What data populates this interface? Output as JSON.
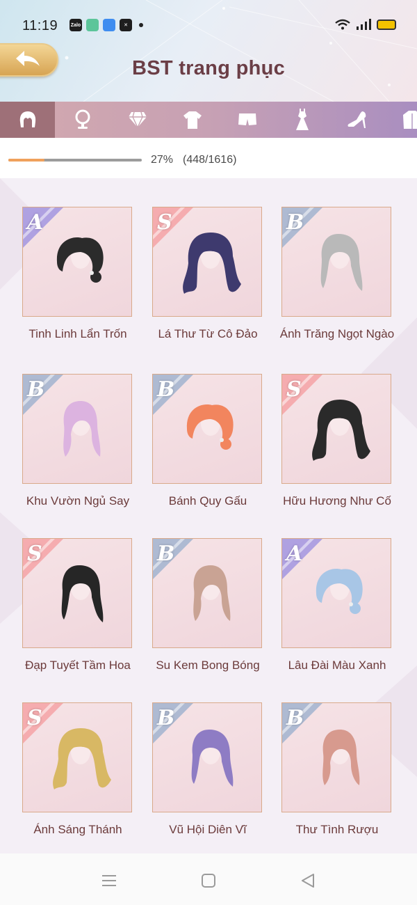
{
  "status": {
    "time": "11:19",
    "apps": [
      {
        "name": "zalo-icon",
        "label": "Zalo",
        "color": "#1e1e1e"
      },
      {
        "name": "app-green-icon",
        "label": "",
        "color": "#5cc59a"
      },
      {
        "name": "app-blue-icon",
        "label": "",
        "color": "#3f8df0"
      },
      {
        "name": "capcut-icon",
        "label": "",
        "color": "#1e1e1e"
      }
    ],
    "icons": [
      "wifi-icon",
      "signal-icon",
      "battery-icon"
    ]
  },
  "header": {
    "title": "BST trang phục",
    "back_icon": "back-arrow-icon",
    "title_color": "#6b3e46"
  },
  "tabs": [
    {
      "id": "hair",
      "icon": "hair-icon",
      "active": true
    },
    {
      "id": "face",
      "icon": "mirror-icon",
      "active": false
    },
    {
      "id": "jewelry",
      "icon": "diamond-icon",
      "active": false
    },
    {
      "id": "top",
      "icon": "shirt-icon",
      "active": false
    },
    {
      "id": "bottom",
      "icon": "shorts-icon",
      "active": false
    },
    {
      "id": "dress",
      "icon": "dress-icon",
      "active": false
    },
    {
      "id": "shoes",
      "icon": "heel-icon",
      "active": false
    },
    {
      "id": "coat",
      "icon": "coat-icon",
      "active": false
    }
  ],
  "progress": {
    "fraction": 0.27,
    "percent_text": "27%",
    "count_text": "(448/1616)"
  },
  "items": [
    {
      "rank": "A",
      "label": "Tinh Linh Lẩn Trốn",
      "hair_color": "#2b2b2b"
    },
    {
      "rank": "S",
      "label": "Lá Thư Từ Cô Đảo",
      "hair_color": "#3e3a6e"
    },
    {
      "rank": "B",
      "label": "Ánh Trăng Ngọt Ngào",
      "hair_color": "#b9b9b9"
    },
    {
      "rank": "B",
      "label": "Khu Vườn Ngủ Say",
      "hair_color": "#dcb3e0"
    },
    {
      "rank": "B",
      "label": "Bánh Quy Gấu",
      "hair_color": "#f2855e"
    },
    {
      "rank": "S",
      "label": "Hữu Hương Như Cố",
      "hair_color": "#2a2a2a"
    },
    {
      "rank": "S",
      "label": "Đạp Tuyết Tầm Hoa",
      "hair_color": "#262626"
    },
    {
      "rank": "B",
      "label": "Su Kem Bong Bóng",
      "hair_color": "#c9a394"
    },
    {
      "rank": "A",
      "label": "Lâu Đài Màu Xanh",
      "hair_color": "#a8c6e6"
    },
    {
      "rank": "S",
      "label": "Ánh Sáng Thánh",
      "hair_color": "#d8b864"
    },
    {
      "rank": "B",
      "label": "Vũ Hội Diên Vĩ",
      "hair_color": "#8e7cc4"
    },
    {
      "rank": "B",
      "label": "Thư Tình Rượu",
      "hair_color": "#d79a8e"
    }
  ],
  "rank_colors": {
    "A": "#a79ae0",
    "S": "#f5a6a8",
    "B": "#a6b6cf"
  },
  "navbar": [
    "menu-icon",
    "home-square-icon",
    "back-triangle-icon"
  ]
}
